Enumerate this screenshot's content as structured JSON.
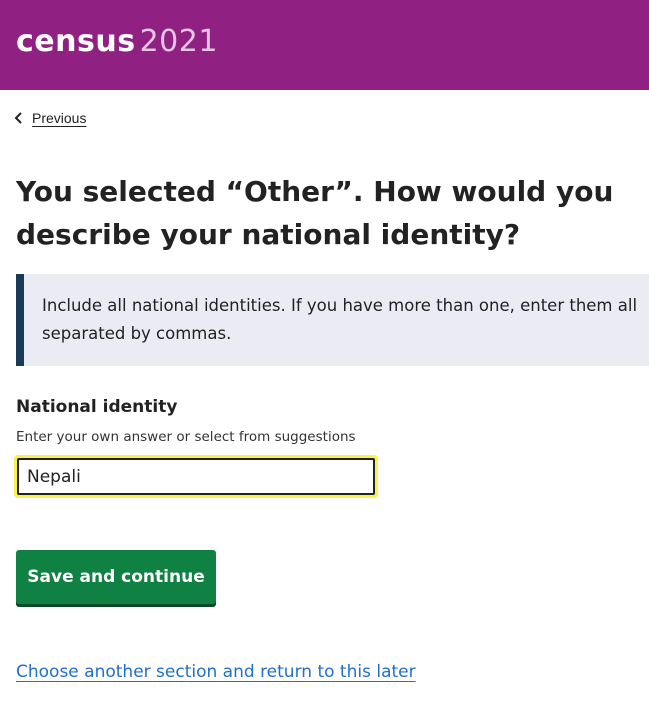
{
  "header": {
    "logo_word": "census",
    "logo_year": "2021",
    "background_color": "#902082"
  },
  "nav": {
    "previous_label": "Previous",
    "previous_icon": "chevron-left-icon"
  },
  "page": {
    "title": "You selected “Other”. How would you describe your national identity?"
  },
  "panel": {
    "text": "Include all national identities. If you have more than one, enter them all separated by commas.",
    "border_color": "#1b3a57",
    "background_color": "#ebebf4"
  },
  "field": {
    "label": "National identity",
    "hint": "Enter your own answer or select from suggestions",
    "value": "Nepali",
    "focus_color": "#fbf14b"
  },
  "actions": {
    "submit_label": "Save and continue",
    "submit_color": "#0f8243",
    "later_link": "Choose another section and return to this later",
    "link_color": "#206fcc"
  }
}
